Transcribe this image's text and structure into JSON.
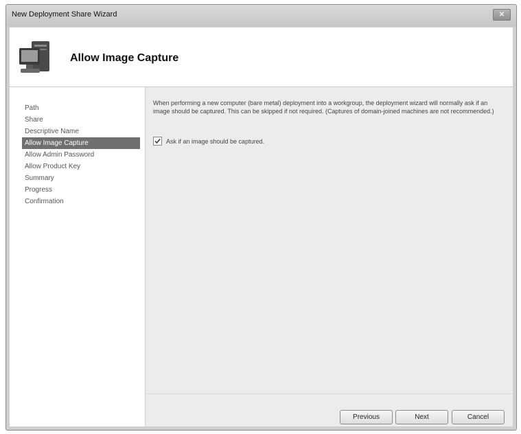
{
  "window": {
    "title": "New Deployment Share Wizard",
    "close_glyph": "✕"
  },
  "header": {
    "title": "Allow Image Capture",
    "icon": "computer-icon"
  },
  "sidebar": {
    "items": [
      {
        "label": "Path"
      },
      {
        "label": "Share"
      },
      {
        "label": "Descriptive Name"
      },
      {
        "label": "Allow Image Capture",
        "active": true
      },
      {
        "label": "Allow Admin Password"
      },
      {
        "label": "Allow Product Key"
      },
      {
        "label": "Summary"
      },
      {
        "label": "Progress"
      },
      {
        "label": "Confirmation"
      }
    ]
  },
  "main": {
    "description": "When performing a new computer (bare metal) deployment into a workgroup, the deployment wizard will normally ask if an image should be captured.  This can be skipped if not required.  (Captures of domain-joined machines are not recommended.)",
    "checkbox": {
      "label": "Ask if an image should be captured.",
      "checked": true
    }
  },
  "buttons": {
    "previous": "Previous",
    "next": "Next",
    "cancel": "Cancel"
  },
  "colors": {
    "active_item_bg": "#6f6f6f",
    "content_bg": "#ececec"
  }
}
